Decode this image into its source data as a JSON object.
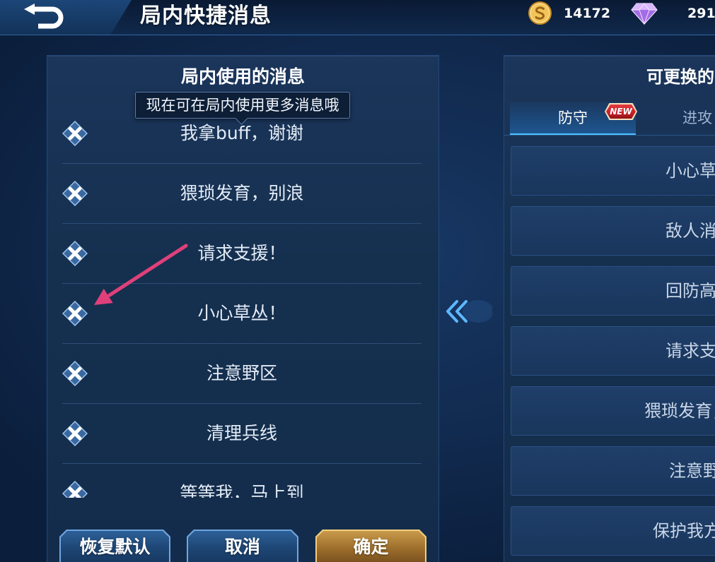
{
  "header": {
    "back_icon": "back-arrow-icon",
    "title": "局内快捷消息",
    "currencies": [
      {
        "icon": "gold-coin-icon",
        "value": "14172"
      },
      {
        "icon": "purple-diamond-icon",
        "value": "291"
      }
    ]
  },
  "in_game_panel": {
    "title": "局内使用的消息",
    "tooltip": "现在可在局内使用更多消息哦",
    "remove_icon": "remove-x-icon",
    "messages": [
      "我拿buff，谢谢",
      "猥琐发育，别浪",
      "请求支援！",
      "小心草丛！",
      "注意野区",
      "清理兵线",
      "等等我，马上到"
    ],
    "buttons": {
      "reset": "恢复默认",
      "cancel": "取消",
      "confirm": "确定"
    }
  },
  "move_icon": "double-chevron-left-icon",
  "available_panel": {
    "title": "可更换的",
    "tabs": [
      {
        "label": "防守",
        "badge": "NEW",
        "active": true
      },
      {
        "label": "进攻",
        "active": false
      }
    ],
    "messages": [
      "小心草",
      "敌人消",
      "回防高",
      "请求支",
      "猥琐发育，",
      "注意野",
      "保护我方"
    ]
  },
  "colors": {
    "accent": "#4ec0ff",
    "confirm_gold": "#c99a4b",
    "badge_red": "#c8202a",
    "annotation_arrow": "#e0407a"
  }
}
